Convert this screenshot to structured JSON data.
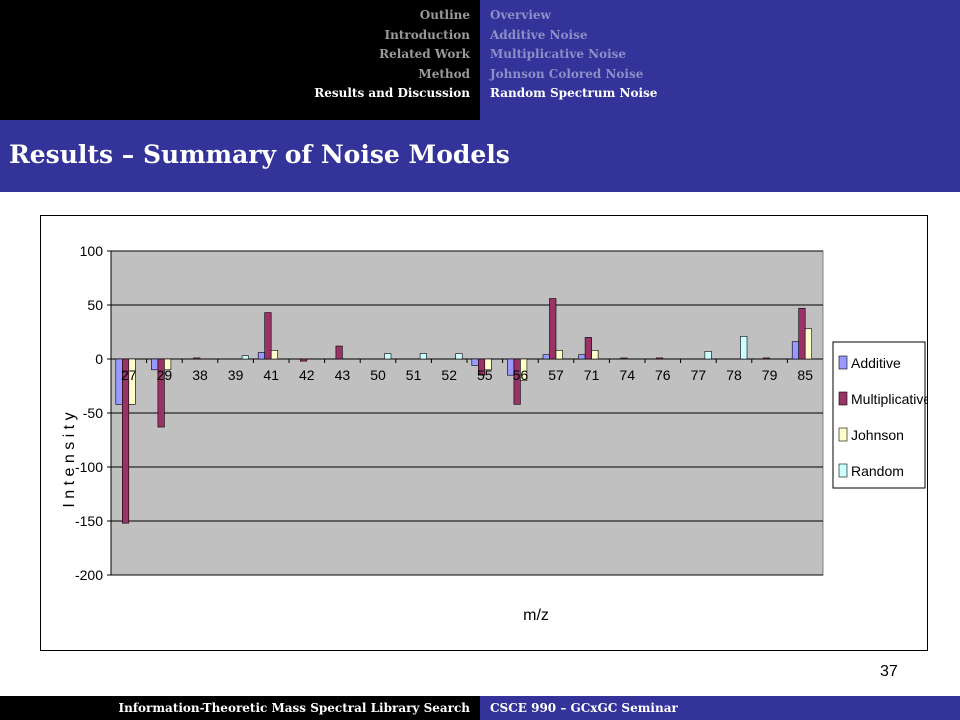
{
  "header": {
    "sections": [
      {
        "label": "Outline",
        "active": false
      },
      {
        "label": "Introduction",
        "active": false
      },
      {
        "label": "Related Work",
        "active": false
      },
      {
        "label": "Method",
        "active": false
      },
      {
        "label": "Results and Discussion",
        "active": true
      }
    ],
    "subsections": [
      {
        "label": "Overview",
        "active": false
      },
      {
        "label": "Additive Noise",
        "active": false
      },
      {
        "label": "Multiplicative  Noise",
        "active": false
      },
      {
        "label": "Johnson Colored Noise",
        "active": false
      },
      {
        "label": "Random Spectrum Noise",
        "active": true
      }
    ]
  },
  "title": "Results – Summary of  Noise Models",
  "footer": {
    "left": "Information-Theoretic Mass Spectral Library Search",
    "right": "CSCE 990 – GCxGC Seminar"
  },
  "slide_number": "37",
  "colors": {
    "header_left_bg": "#000000",
    "header_right_bg": "#333399",
    "plot_area": "#c0c0c0",
    "additive": "#9999ff",
    "multiplicative": "#993366",
    "johnson": "#ffffcc",
    "random": "#ccffff"
  },
  "chart_data": {
    "type": "bar",
    "xlabel": "m/z",
    "ylabel": "I n t e n s i t y",
    "ylim": [
      -200,
      100
    ],
    "yticks": [
      100,
      50,
      0,
      -50,
      -100,
      -150,
      -200
    ],
    "grid": true,
    "legend_position": "right",
    "categories": [
      "27",
      "29",
      "38",
      "39",
      "41",
      "42",
      "43",
      "50",
      "51",
      "52",
      "55",
      "56",
      "57",
      "71",
      "74",
      "76",
      "77",
      "78",
      "79",
      "85"
    ],
    "series": [
      {
        "name": "Additive",
        "color": "#9999ff",
        "values": [
          -42,
          -10,
          0,
          0,
          6,
          0,
          0,
          0,
          0,
          0,
          -6,
          -15,
          4,
          4,
          0,
          0,
          0,
          0,
          0,
          16
        ]
      },
      {
        "name": "Multiplicative",
        "color": "#993366",
        "values": [
          -152,
          -63,
          1,
          0,
          43,
          -2,
          12,
          0,
          0,
          0,
          -15,
          -42,
          56,
          20,
          1,
          1,
          0,
          0,
          1,
          47
        ]
      },
      {
        "name": "Johnson",
        "color": "#ffffcc",
        "values": [
          -42,
          -10,
          0,
          0,
          8,
          0,
          0,
          0,
          0,
          0,
          -10,
          -20,
          8,
          8,
          0,
          0,
          0,
          0,
          0,
          28
        ]
      },
      {
        "name": "Random",
        "color": "#ccffff",
        "values": [
          0,
          0,
          0,
          3,
          0,
          0,
          0,
          5,
          5,
          5,
          0,
          0,
          0,
          0,
          0,
          0,
          7,
          21,
          0,
          0
        ]
      }
    ]
  }
}
